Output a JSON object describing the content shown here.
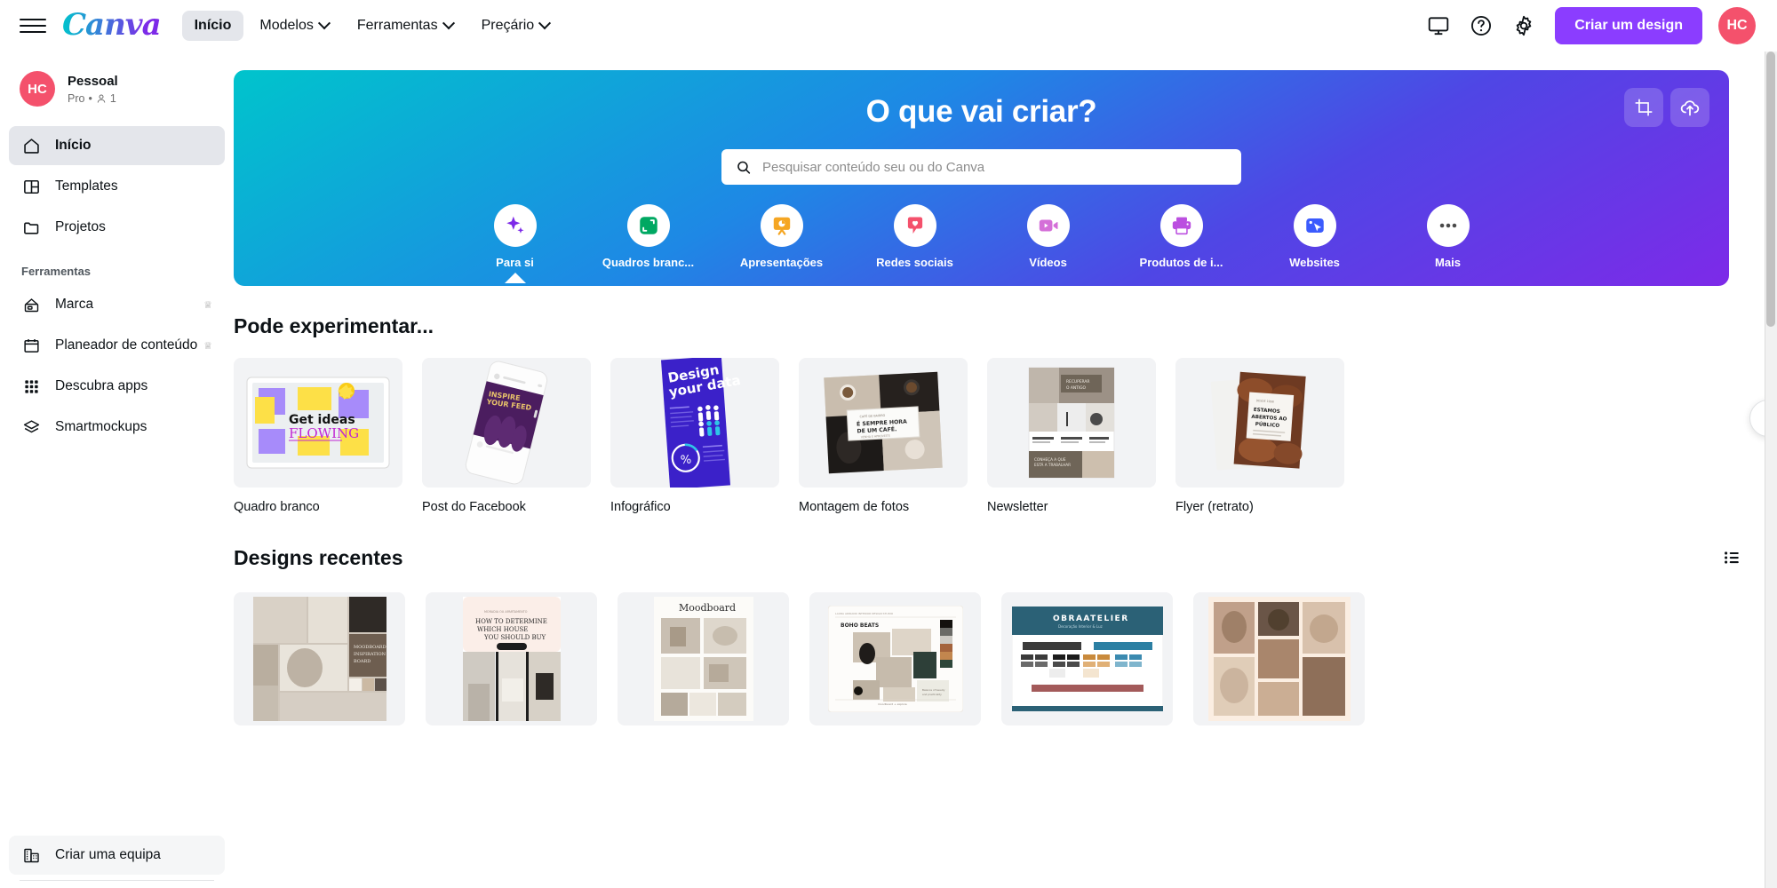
{
  "header": {
    "menu_icon": "hamburger-icon",
    "logo": "Canva",
    "nav": [
      {
        "label": "Início",
        "active": true,
        "has_chevron": false
      },
      {
        "label": "Modelos",
        "active": false,
        "has_chevron": true
      },
      {
        "label": "Ferramentas",
        "active": false,
        "has_chevron": true
      },
      {
        "label": "Preçário",
        "active": false,
        "has_chevron": true
      }
    ],
    "icons": [
      {
        "name": "monitor-icon"
      },
      {
        "name": "help-icon"
      },
      {
        "name": "gear-icon"
      }
    ],
    "create_button": "Criar um design",
    "avatar_initials": "HC",
    "avatar_color": "#f4516c",
    "accent_color": "#8b3dff"
  },
  "sidebar": {
    "account": {
      "avatar_initials": "HC",
      "name": "Pessoal",
      "plan": "Pro",
      "separator": "•",
      "members_icon": "person-icon",
      "members_count": "1"
    },
    "items": [
      {
        "label": "Início",
        "icon": "home-icon",
        "active": true,
        "pro": false
      },
      {
        "label": "Templates",
        "icon": "template-icon",
        "active": false,
        "pro": false
      },
      {
        "label": "Projetos",
        "icon": "folder-icon",
        "active": false,
        "pro": false
      }
    ],
    "tools_label": "Ferramentas",
    "tools": [
      {
        "label": "Marca",
        "icon": "brand-icon",
        "pro": true
      },
      {
        "label": "Planeador de conteúdo",
        "icon": "calendar-icon",
        "pro": true
      },
      {
        "label": "Descubra apps",
        "icon": "apps-grid-icon",
        "pro": false
      },
      {
        "label": "Smartmockups",
        "icon": "layers-icon",
        "pro": false
      }
    ],
    "bottom": {
      "label": "Criar uma equipa",
      "icon": "building-icon"
    }
  },
  "hero": {
    "title": "O que vai criar?",
    "actions": [
      {
        "name": "crop-icon"
      },
      {
        "name": "cloud-upload-icon"
      }
    ],
    "search": {
      "placeholder": "Pesquisar conteúdo seu ou do Canva",
      "value": "",
      "icon": "search-icon"
    },
    "categories": [
      {
        "label": "Para si",
        "icon": "sparkle-icon",
        "color": "#7d2ae8",
        "selected": true
      },
      {
        "label": "Quadros branc...",
        "icon": "whiteboard-icon",
        "color": "#00a862",
        "selected": false
      },
      {
        "label": "Apresentações",
        "icon": "presentation-icon",
        "color": "#f5a623",
        "selected": false
      },
      {
        "label": "Redes sociais",
        "icon": "heart-pin-icon",
        "color": "#f4516c",
        "selected": false
      },
      {
        "label": "Vídeos",
        "icon": "video-icon",
        "color": "#d46fd8",
        "selected": false
      },
      {
        "label": "Produtos de i...",
        "icon": "printer-icon",
        "color": "#bb4fe0",
        "selected": false
      },
      {
        "label": "Websites",
        "icon": "website-cursor-icon",
        "color": "#3b5bfd",
        "selected": false
      },
      {
        "label": "Mais",
        "icon": "more-dots-icon",
        "color": "#4a4a4a",
        "selected": false
      }
    ]
  },
  "try_section": {
    "title": "Pode experimentar...",
    "next_label": "›",
    "cards": [
      {
        "label": "Quadro branco",
        "thumb": "whiteboard-get-ideas-flowing",
        "text_lines": [
          "Get ideas",
          "FLOWING"
        ]
      },
      {
        "label": "Post do Facebook",
        "thumb": "phone-inspire-your-feed",
        "text_lines": [
          "INSPIRE",
          "YOUR FEED"
        ]
      },
      {
        "label": "Infográfico",
        "thumb": "infographic-design-your-data",
        "text_lines": [
          "Design",
          "your data",
          "%"
        ]
      },
      {
        "label": "Montagem de fotos",
        "thumb": "photo-collage-cafe",
        "text_lines": [
          "É SEMPRE HORA",
          "DE UM CAFÉ."
        ]
      },
      {
        "label": "Newsletter",
        "thumb": "newsletter-layout",
        "text_lines": []
      },
      {
        "label": "Flyer (retrato)",
        "thumb": "flyer-portrait-food",
        "text_lines": [
          "ESTAMOS",
          "ABERTOS AO",
          "PÚBLICO"
        ]
      }
    ]
  },
  "recent_section": {
    "title": "Designs recentes",
    "view_toggle_icon": "list-view-icon",
    "cards": [
      {
        "thumb": "interior-inspiration-board",
        "text": "MOODBOARD INSPIRATION BOARD"
      },
      {
        "thumb": "how-to-determine-house",
        "text": "HOW TO DETERMINE WHICH HOUSE YOU SHOULD BUY"
      },
      {
        "thumb": "moodboard-interior",
        "text": "Moodboard"
      },
      {
        "thumb": "boho-beats-moodboard",
        "text": "BOHO BEATS"
      },
      {
        "thumb": "obraatelier-brand",
        "text": "OBRAATELIER"
      },
      {
        "thumb": "warm-collage-grid",
        "text": ""
      }
    ]
  }
}
